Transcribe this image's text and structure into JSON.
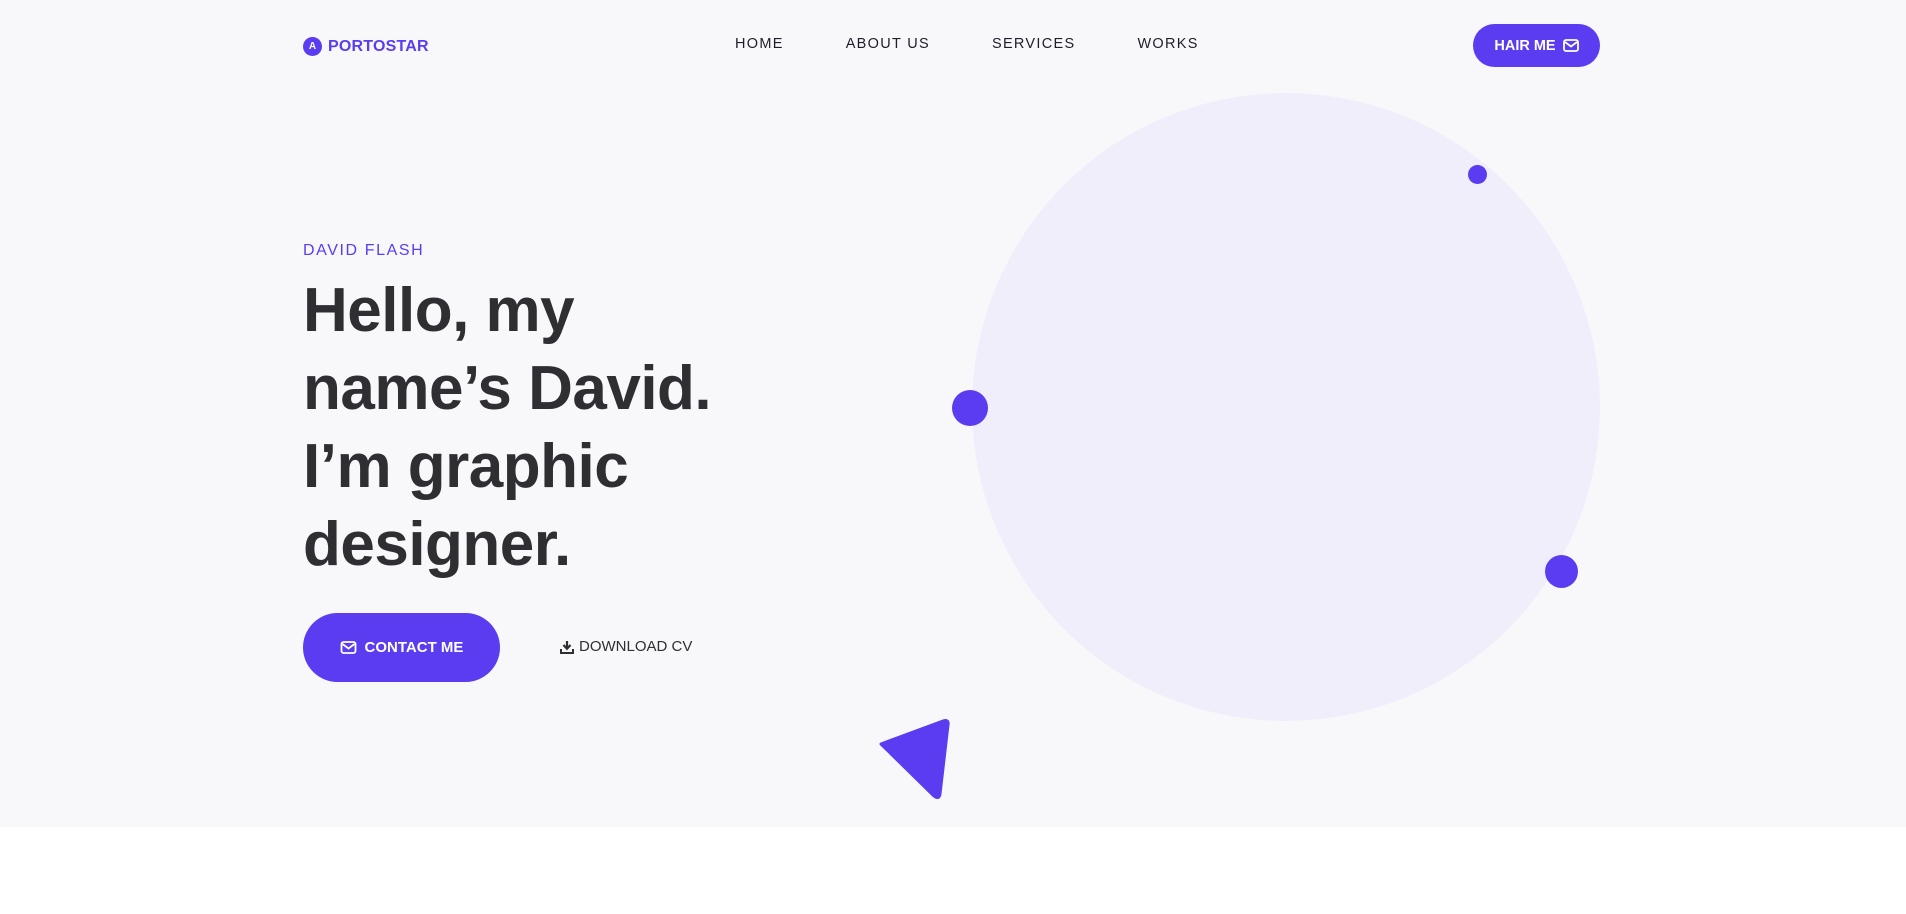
{
  "header": {
    "logo_mark": "A",
    "logo_text": "PORTOSTAR",
    "nav": [
      "HOME",
      "ABOUT US",
      "SERVICES",
      "WORKS"
    ],
    "cta_label": "HAIR ME",
    "cta_icon": "mail-icon"
  },
  "hero": {
    "subtitle": "DAVID FLASH",
    "headline_lines": [
      "Hello, my",
      "name’s David.",
      "I’m graphic",
      "designer."
    ],
    "contact_label": "CONTACT ME",
    "contact_icon": "mail-icon",
    "download_label": "DOWNLOAD CV",
    "download_icon": "download-icon"
  },
  "colors": {
    "accent": "#5b3cf0",
    "hero_bg": "#f8f8fb",
    "circle_bg": "#f1eefb",
    "text_dark": "#2e2e33"
  }
}
